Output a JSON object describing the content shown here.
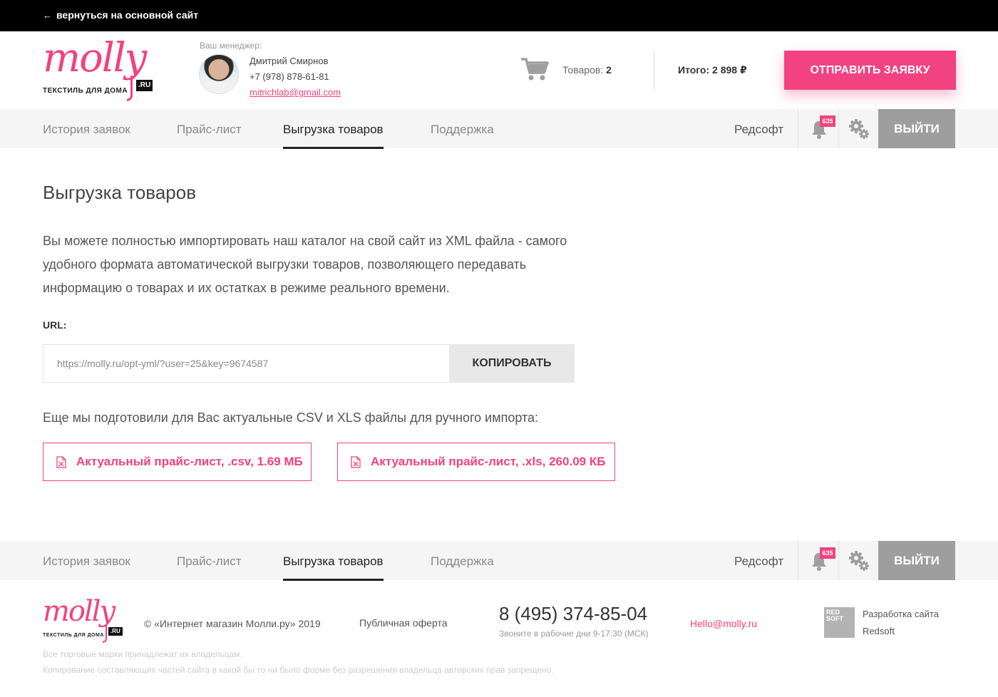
{
  "topbar": {
    "back_label": "вернуться на основной сайт"
  },
  "brand": {
    "name": "molly",
    "tld": ".RU",
    "tagline": "ТЕКСТИЛЬ ДЛЯ ДОМА",
    "accent_color": "#f2427f"
  },
  "manager": {
    "label": "Ваш менеджер:",
    "name": "Дмитрий Смирнов",
    "phone": "+7 (978) 878-61-81",
    "email": "mitrichlab@gmail.com"
  },
  "cart": {
    "label": "Товаров:",
    "count": "2",
    "total": "Итого: 2 898 ₽"
  },
  "header": {
    "submit_label": "ОТПРАВИТЬ ЗАЯВКУ"
  },
  "nav": {
    "items": [
      {
        "label": "История заявок"
      },
      {
        "label": "Прайс-лист"
      },
      {
        "label": "Выгрузка товаров"
      },
      {
        "label": "Поддержка"
      }
    ],
    "active_index": 2,
    "user": "Редсофт",
    "notifications": "635",
    "logout_label": "ВЫЙТИ"
  },
  "main": {
    "title": "Выгрузка товаров",
    "intro": "Вы можете полностью импортировать наш каталог на свой сайт из XML файла - самого удобного формата автоматической выгрузки товаров, позволяющего передавать информацию о товарах и их остатках в режиме реального времени.",
    "url_label": "URL:",
    "url_value": "https://molly.ru/opt-yml/?user=25&key=9674587",
    "copy_label": "КОПИРОВАТЬ",
    "files_note": "Еще мы подготовили для Вас актуальные CSV и XLS файлы для ручного импорта:",
    "files": [
      {
        "label": "Актуальный прайс-лист, .csv, 1.69 МБ"
      },
      {
        "label": "Актуальный прайс-лист, .xls, 260.09 КБ"
      }
    ]
  },
  "footer": {
    "copyright": "© «Интернет магазин Молли.ру» 2019",
    "offer": "Публичная оферта",
    "phone": "8 (495) 374-85-04",
    "hours": "Звоните в рабочие дни 9-17:30 (МСК)",
    "email": "Hello@molly.ru",
    "dev_logo": "RED SOFT",
    "dev_line1": "Разработка сайта",
    "dev_line2": "Redsoft",
    "legal1": "Все торговые марки принадлежат их владельцам.",
    "legal2": "Копирование составляющих частей сайта в какой бы то ни было форме без разрешения владельца авторских прав запрещено."
  }
}
